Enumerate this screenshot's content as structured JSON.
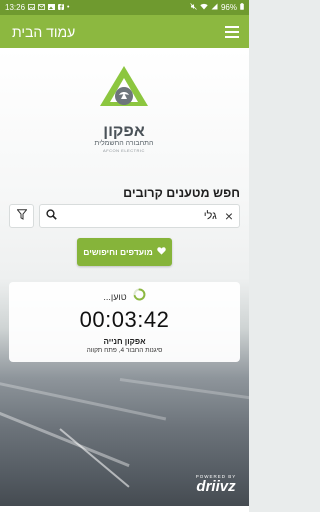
{
  "status_bar": {
    "time": "13:26",
    "battery": "96%",
    "left_icons": [
      "image-icon",
      "mail-icon",
      "gallery-icon",
      "facebook-icon",
      "more-dots-icon"
    ],
    "right_icons": [
      "mute-icon",
      "wifi-icon",
      "signal-icon",
      "battery-icon"
    ]
  },
  "app_bar": {
    "title": "עמוד הבית",
    "menu_icon": "hamburger-menu-icon"
  },
  "logo": {
    "name": "אפקון",
    "subtitle": "התחבורה החשמלית",
    "tagline": "AFCON ELECTRIC"
  },
  "search": {
    "heading": "חפש מטענים קרובים",
    "value": "גלי",
    "clear_icon": "×",
    "search_icon": "search-icon",
    "filter_icon": "filter-icon"
  },
  "favorites_button": {
    "label": "מועדפים וחיפושים",
    "icon": "heart-icon"
  },
  "charging_card": {
    "status": "טוען...",
    "timer": "00:03:42",
    "station_name": "אפקון חנייה",
    "address": "סיגנות החבור 4, פתח תקווה"
  },
  "powered_by": {
    "label": "POWERED BY",
    "brand": "driivz"
  },
  "colors": {
    "status_bar": "#6f9a2f",
    "app_bar": "#8cb840",
    "button": "#86b43a",
    "logo_accent": "#8cc63f"
  }
}
